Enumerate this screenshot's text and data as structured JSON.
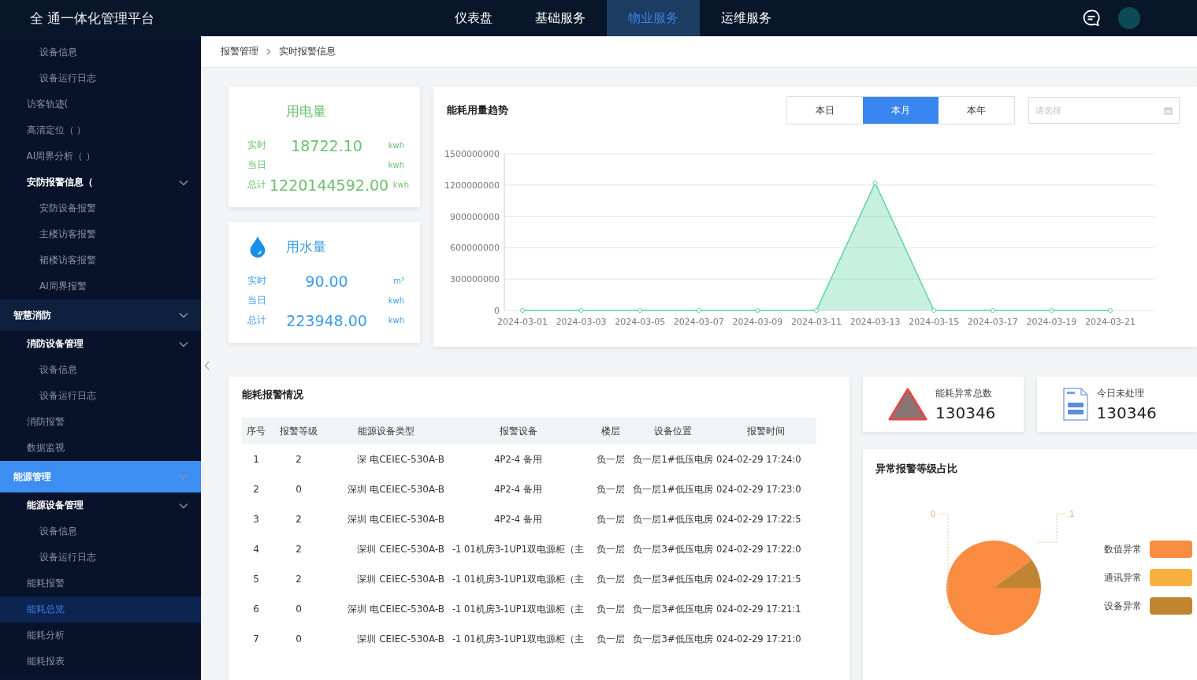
{
  "header": {
    "title": "全 通一体化管理平台",
    "nav": [
      {
        "label": "仪表盘",
        "selected": false
      },
      {
        "label": "基础服务",
        "selected": false
      },
      {
        "label": "物业服务",
        "selected": true
      },
      {
        "label": "运维服务",
        "selected": false
      }
    ]
  },
  "sidebar": {
    "items": [
      {
        "children": [
          {
            "children": [
              {
                "label": "设备信息",
                "selected": false
              },
              {
                "label": "设备运行日志",
                "selected": false
              }
            ]
          },
          {
            "label": "访客轨迹(",
            "selected": false
          },
          {
            "label": "高清定位（ ）",
            "selected": false
          },
          {
            "label": "AI周界分析（ ）",
            "selected": false
          },
          {
            "label": "安防报警信息（",
            "selected": false,
            "expanded": true,
            "children": [
              {
                "label": "安防设备报警",
                "selected": false
              },
              {
                "label": "主楼访客报警",
                "selected": false
              },
              {
                "label": "裙楼访客报警",
                "selected": false
              },
              {
                "label": "AI周界报警",
                "selected": false
              }
            ]
          }
        ]
      },
      {
        "label": "智慧消防",
        "selected": false,
        "expanded": true,
        "children": [
          {
            "label": "消防设备管理",
            "selected": false,
            "expanded": true,
            "children": [
              {
                "label": "设备信息",
                "selected": false
              },
              {
                "label": "设备运行日志",
                "selected": false
              }
            ]
          },
          {
            "label": "消防报警",
            "selected": false
          },
          {
            "label": "数据监视",
            "selected": false
          }
        ]
      },
      {
        "label": "能源管理",
        "selected": true,
        "expanded": true,
        "children": [
          {
            "label": "能源设备管理",
            "selected": false,
            "expanded": true,
            "children": [
              {
                "label": "设备信息",
                "selected": false
              },
              {
                "label": "设备运行日志",
                "selected": false
              }
            ]
          },
          {
            "label": "能耗报警",
            "selected": false
          },
          {
            "label": "能耗总览",
            "selected": true
          },
          {
            "label": "能耗分析",
            "selected": false
          },
          {
            "label": "能耗报表",
            "selected": false
          }
        ]
      }
    ]
  },
  "breadcrumb": [
    "报警管理",
    "实时报警信息"
  ],
  "meters": [
    {
      "kind": "electric",
      "color": "#6dbf6d",
      "title": "用电量",
      "rows": [
        {
          "label": "实时",
          "value": "18722.10",
          "unit": "kwh"
        },
        {
          "label": "当日",
          "unit": "kwh"
        },
        {
          "label": "总计",
          "value": "1220144592.00",
          "unit": "kwh"
        }
      ]
    },
    {
      "kind": "water",
      "color": "#3d9be9",
      "title": "用水量",
      "rows": [
        {
          "label": "实时",
          "value": "90.00",
          "unit": "m³"
        },
        {
          "label": "当日",
          "unit": "kwh"
        },
        {
          "label": "总计",
          "value": "223948.00",
          "unit": "kwh"
        }
      ]
    }
  ],
  "trend": {
    "title": "能耗用量趋势",
    "periods": [
      {
        "label": "本日",
        "selected": false
      },
      {
        "label": "本月",
        "selected": true
      },
      {
        "label": "本年",
        "selected": false
      }
    ],
    "date_field": {
      "placeholder": "请选择"
    },
    "chart_data": {
      "type": "area",
      "categories": [
        "2024-03-01",
        "2024-03-03",
        "2024-03-05",
        "2024-03-07",
        "2024-03-09",
        "2024-03-11",
        "2024-03-13",
        "2024-03-15",
        "2024-03-17",
        "2024-03-19",
        "2024-03-21"
      ],
      "series": [
        {
          "color": "#5fd3a0",
          "values": [
            0,
            0,
            0,
            0,
            0,
            0,
            1220000000,
            0,
            0,
            0,
            0
          ]
        }
      ],
      "ylim": [
        0,
        1500000000
      ],
      "yticks": [
        0,
        300000000,
        600000000,
        900000000,
        1200000000,
        1500000000
      ],
      "grid": true
    }
  },
  "alarm_table": {
    "title": "能耗报警情况",
    "columns": [
      "序号",
      "报警等级",
      "能源设备类型",
      "报警设备",
      "楼层",
      "设备位置",
      "报警时间"
    ],
    "rows": [
      [
        "1",
        "2",
        "深 电CEIEC-530A-B",
        "4P2-4 备用",
        "负一层",
        "负一层1#低压电房",
        "024-02-29 17:24:0"
      ],
      [
        "2",
        "0",
        "深圳 电CEIEC-530A-B",
        "4P2-4 备用",
        "负一层",
        "负一层1#低压电房",
        "024-02-29 17:23:0"
      ],
      [
        "3",
        "2",
        "深圳 电CEIEC-530A-B",
        "4P2-4 备用",
        "负一层",
        "负一层1#低压电房",
        "024-02-29 17:22:5"
      ],
      [
        "4",
        "2",
        "深圳 CEIEC-530A-B",
        "-1 01机房3-1UP1双电源柜（主",
        "负一层",
        "负一层3#低压电房",
        "024-02-29 17:22:0"
      ],
      [
        "5",
        "2",
        "深圳 CEIEC-530A-B",
        "-1 01机房3-1UP1双电源柜（主",
        "负一层",
        "负一层3#低压电房",
        "024-02-29 17:21:5"
      ],
      [
        "6",
        "0",
        "深圳 电CEIEC-530A-B",
        "-1 01机房3-1UP1双电源柜（主",
        "负一层",
        "负一层3#低压电房",
        "024-02-29 17:21:1"
      ],
      [
        "7",
        "0",
        "深圳 CEIEC-530A-B",
        "-1 01机房3-1UP1双电源柜（主",
        "负一层",
        "负一层3#低压电房",
        "024-02-29 17:21:0"
      ]
    ]
  },
  "stats": [
    {
      "kind": "warning",
      "label": "能耗异常总数",
      "value": "130346"
    },
    {
      "kind": "document",
      "label": "今日未处理",
      "value": "130346"
    }
  ],
  "ratio": {
    "title": "异常报警等级占比",
    "callouts": [
      "0",
      "1"
    ],
    "chart_data": {
      "type": "pie",
      "categories": [
        "数值异常",
        "通讯异常",
        "设备异常"
      ],
      "colors": [
        "#f98c40",
        "#f7b040",
        "#c08530"
      ],
      "series": [
        {
          "values": [
            90,
            0,
            10
          ]
        }
      ]
    }
  }
}
